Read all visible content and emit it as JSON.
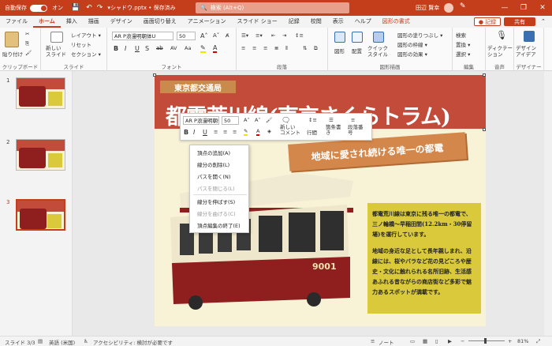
{
  "titlebar": {
    "autosave_label": "自動保存",
    "toggle_state": "オン",
    "filename": "シャドウ.pptx • 保存済み",
    "search_placeholder": "検索 (Alt+Q)",
    "user": "田辺 賢幸",
    "min": "—",
    "restore": "❐",
    "close": "✕"
  },
  "tabs": [
    "ファイル",
    "ホーム",
    "挿入",
    "描画",
    "デザイン",
    "画面切り替え",
    "アニメーション",
    "スライド ショー",
    "記録",
    "校閲",
    "表示",
    "ヘルプ",
    "図形の書式"
  ],
  "tab_buttons": {
    "record": "● 記録",
    "share": "共有"
  },
  "ribbon": {
    "clipboard": {
      "label": "クリップボード",
      "paste": "貼り付け"
    },
    "slides": {
      "label": "スライド",
      "new_slide": "新しい\nスライド",
      "layout": "レイアウト ▾",
      "reset": "リセット",
      "section": "セクション ▾"
    },
    "font": {
      "label": "フォント",
      "font_name": "AR P浪漫明朝体U",
      "font_size": "50"
    },
    "paragraph": {
      "label": "段落"
    },
    "drawing": {
      "label": "図形描画",
      "shapes": "図形",
      "arrange": "配置",
      "quick_styles": "クイック\nスタイル",
      "fill": "図形の塗りつぶし ▾",
      "outline": "図形の枠線 ▾",
      "effects": "図形の効果 ▾"
    },
    "editing": {
      "label": "編集",
      "find": "検索",
      "replace": "置換 ▾",
      "select": "選択 ▾"
    },
    "voice": {
      "label": "音声",
      "dictate": "ディクテー\nション"
    },
    "designer": {
      "label": "デザイナー",
      "ideas": "デザイン\nアイデア"
    }
  },
  "thumbnails": [
    "1",
    "2",
    "3"
  ],
  "slide": {
    "tag": "東京都交通局",
    "title": "都電荒川線(東京さくらトラム)",
    "subtitle": "地域に愛され続ける唯一の都電",
    "tram_number": "9001",
    "desc1": "都電荒川線は東京に残る唯一の都電で、三ノ輪橋〜早稲田間(12.2km・30停留場)を運行しています。",
    "desc2": "地域の身近な足として長年親しまれ、沿線には、桜やバラなど花の見どころや歴史・文化に触れられる名所旧跡、生活感あふれる昔ながらの商店街など多彩で魅力あるスポットが満載です。"
  },
  "mini_toolbar": {
    "font_name": "AR P浪漫明朝体",
    "font_size": "50",
    "new_comment": "新しい\nコメント",
    "line_spacing": "行間",
    "bullets": "箇条書\nき",
    "numbering": "段落番\n号"
  },
  "context_menu": {
    "items": [
      {
        "label": "頂点の追加(A)",
        "enabled": true
      },
      {
        "label": "線分の削除(L)",
        "enabled": true
      },
      {
        "label": "パスを開く(N)",
        "enabled": true
      },
      {
        "label": "パスを閉じる(L)",
        "enabled": false
      },
      {
        "label": "線分を伸ばす(S)",
        "enabled": true
      },
      {
        "label": "線分を曲げる(C)",
        "enabled": false
      },
      {
        "label": "頂点編集の終了(E)",
        "enabled": true
      }
    ]
  },
  "status": {
    "slide": "スライド 3/3",
    "language": "英語 (米国)",
    "accessibility": "アクセシビリティ: 検討が必要です",
    "notes": "ノート",
    "zoom": "81%"
  },
  "colors": {
    "accent": "#c43e1c",
    "banner": "#c24b3a",
    "slide_bg": "#f8f3d6",
    "desc_bg": "#d9c93b",
    "sub_banner": "#d4874a",
    "tram_red": "#8f1f1f"
  }
}
